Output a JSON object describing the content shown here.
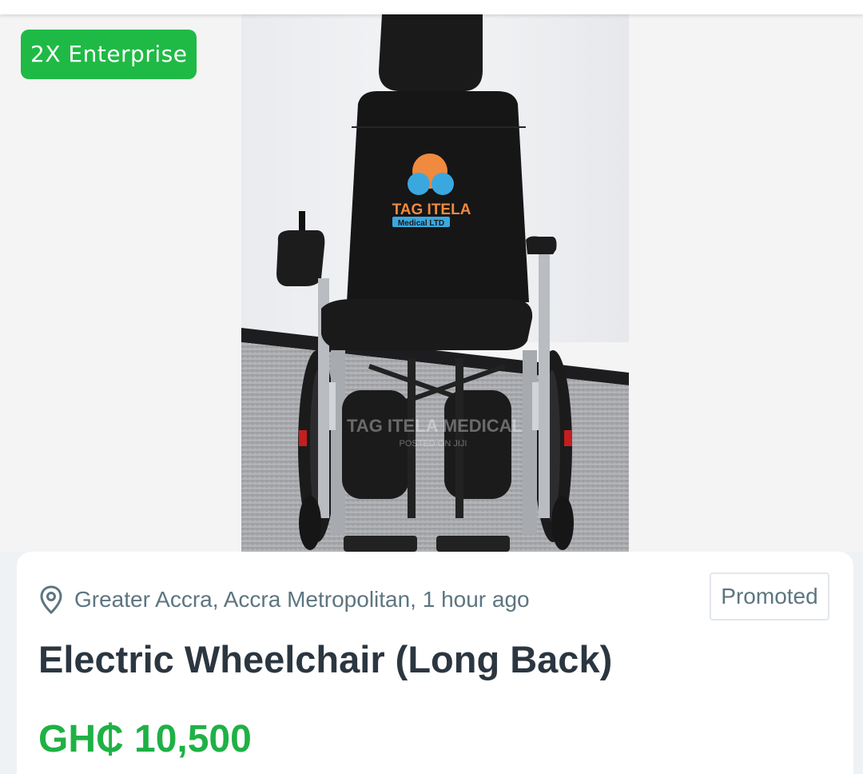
{
  "gallery": {
    "badge_label": "2X Enterprise",
    "photo": {
      "logo_text": "TAG ITELA",
      "logo_subtext": "Medical LTD",
      "watermark": "TAG ITELA MEDICAL",
      "watermark_sub": "POSTED ON JIJI"
    }
  },
  "listing": {
    "location_icon": "location-pin-icon",
    "location": "Greater Accra, Accra Metropolitan, 1 hour ago",
    "promoted_label": "Promoted",
    "title": "Electric Wheelchair (Long Back)",
    "price": "GH₵ 10,500"
  },
  "colors": {
    "accent_green": "#1fba45",
    "price_green": "#1fb145",
    "muted_text": "#5d7581",
    "title_text": "#2b3640"
  }
}
